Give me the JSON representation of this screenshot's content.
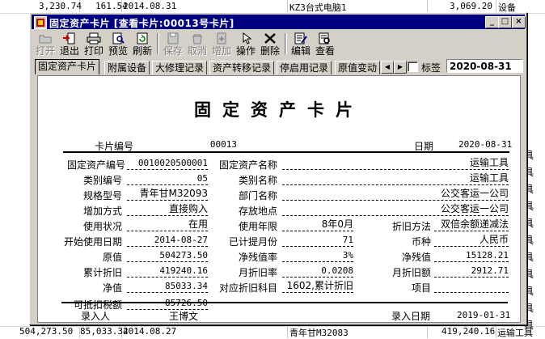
{
  "background": {
    "top_row": {
      "c1": "3,230.74",
      "c2": "161.54",
      "c3": "2014.08.31",
      "c4": "KZ3台式电脑1",
      "c5": "3,069.20",
      "c6": "设备"
    },
    "bottom_row": {
      "c1": "504,273.50",
      "c2": "85,033.34",
      "c3": "2014.08.27",
      "c4": "青年甘M32083",
      "c5": "419,240.16",
      "c6": "运输工具"
    },
    "right_cells": [
      "具",
      "具",
      "具",
      "具",
      "具",
      "具",
      "具",
      "具",
      "具",
      "具",
      "具",
      "具"
    ]
  },
  "window": {
    "title": "固定资产卡片",
    "title_suffix": "[查看卡片:00013号卡片]",
    "min_label": "_",
    "max_label": "□",
    "close_label": "×"
  },
  "toolbar": {
    "open": "打开",
    "exit": "退出",
    "print": "打印",
    "preview": "预览",
    "refresh": "刷新",
    "save": "保存",
    "cancel": "取消",
    "add": "增加",
    "operate": "操作",
    "delete": "删除",
    "edit": "编辑",
    "view": "查看"
  },
  "tabs": [
    "固定资产卡片",
    "附属设备",
    "大修理记录",
    "资产转移记录",
    "停启用记录",
    "原值变动"
  ],
  "tab_nav": {
    "left": "◀",
    "right": "▶"
  },
  "tag_label": "标签",
  "tag_date": "2020-08-31",
  "card": {
    "title": "固定资产卡片",
    "card_no_label": "卡片编号",
    "card_no": "00013",
    "date_label": "日期",
    "date": "2020-08-31",
    "fields": {
      "asset_code_label": "固定资产编号",
      "asset_code": "0010020500001",
      "asset_name_label": "固定资产名称",
      "asset_name": "运输工具",
      "category_code_label": "类别编号",
      "category_code": "05",
      "category_name_label": "类别名称",
      "category_name": "运输工具",
      "model_label": "规格型号",
      "model": "青年甘M32093",
      "dept_label": "部门名称",
      "dept": "公交客运一公司",
      "add_method_label": "增加方式",
      "add_method": "直接购入",
      "location_label": "存放地点",
      "location": "公交客运一公司",
      "status_label": "使用状况",
      "status": "在用",
      "life_label": "使用年限",
      "life": "8年0月",
      "dep_method_label": "折旧方法",
      "dep_method": "双倍余额递减法",
      "start_date_label": "开始使用日期",
      "start_date": "2014-08-27",
      "months_label": "已计提月份",
      "months": "71",
      "currency_label": "币种",
      "currency": "人民币",
      "orig_label": "原值",
      "orig": "504273.50",
      "residual_rate_label": "净残值率",
      "residual_rate": "3%",
      "residual_label": "净残值",
      "residual": "15128.21",
      "acc_dep_label": "累计折旧",
      "acc_dep": "419240.16",
      "monthly_rate_label": "月折旧率",
      "monthly_rate": "0.0208",
      "monthly_amt_label": "月折旧额",
      "monthly_amt": "2912.71",
      "net_label": "净值",
      "net": "85033.34",
      "dep_subject_label": "对应折旧科目",
      "dep_subject": "1602,累计折旧",
      "item_label": "项目",
      "item": "",
      "deductible_label": "可抵扣税额",
      "deductible": "85726.50"
    },
    "recorder_label": "录入人",
    "recorder": "王博文",
    "record_date_label": "录入日期",
    "record_date": "2019-01-31"
  }
}
